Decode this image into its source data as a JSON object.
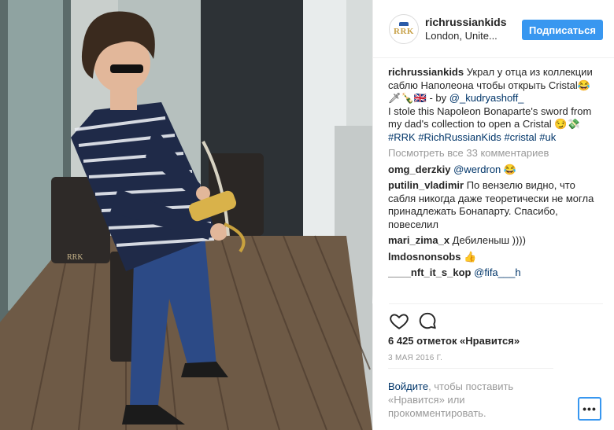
{
  "post": {
    "username": "richrussiankids",
    "location": "London, Unite...",
    "follow_label": "Подписаться",
    "avatar_text": "RRK",
    "caption_user": "richrussiankids",
    "caption_line1": " Украл у отца из коллекции саблю Наполеона чтобы открыть Cristal😂🗡🍾🇬🇧 - by ",
    "caption_mention": "@_kudryashoff_",
    "caption_line2": "I stole this Napoleon Bonaparte's sword from my dad's collection to open a Cristal 😏💸",
    "hashtags": [
      "#RRK",
      "#RichRussianKids",
      "#cristal",
      "#uk"
    ],
    "view_all": "Посмотреть все 33 комментариев",
    "comments": [
      {
        "user": "omg_derzkiy",
        "mention": "@werdron",
        "text": " 😂"
      },
      {
        "user": "putilin_vladimir",
        "mention": "",
        "text": " По вензелю видно, что сабля никогда даже теоретически не могла принадлежать Бонапарту. Спасибо, повеселил"
      },
      {
        "user": "mari_zima_x",
        "mention": "",
        "text": " Дебиленыш ))))"
      },
      {
        "user": "lmdosnonsobs",
        "mention": "",
        "text": " 👍"
      },
      {
        "user": "____nft_it_s_kop",
        "mention": "@fifa___h",
        "text": ""
      }
    ],
    "likes": "6 425 отметок «Нравится»",
    "date": "3 МАЯ 2016 Г.",
    "login_link": "Войдите",
    "login_text": ", чтобы поставить «Нравится» или прокомментировать.",
    "more_label": "•••",
    "icons": {
      "like": "heart-icon",
      "comment": "comment-bubble-icon",
      "more": "more-options-icon"
    }
  }
}
